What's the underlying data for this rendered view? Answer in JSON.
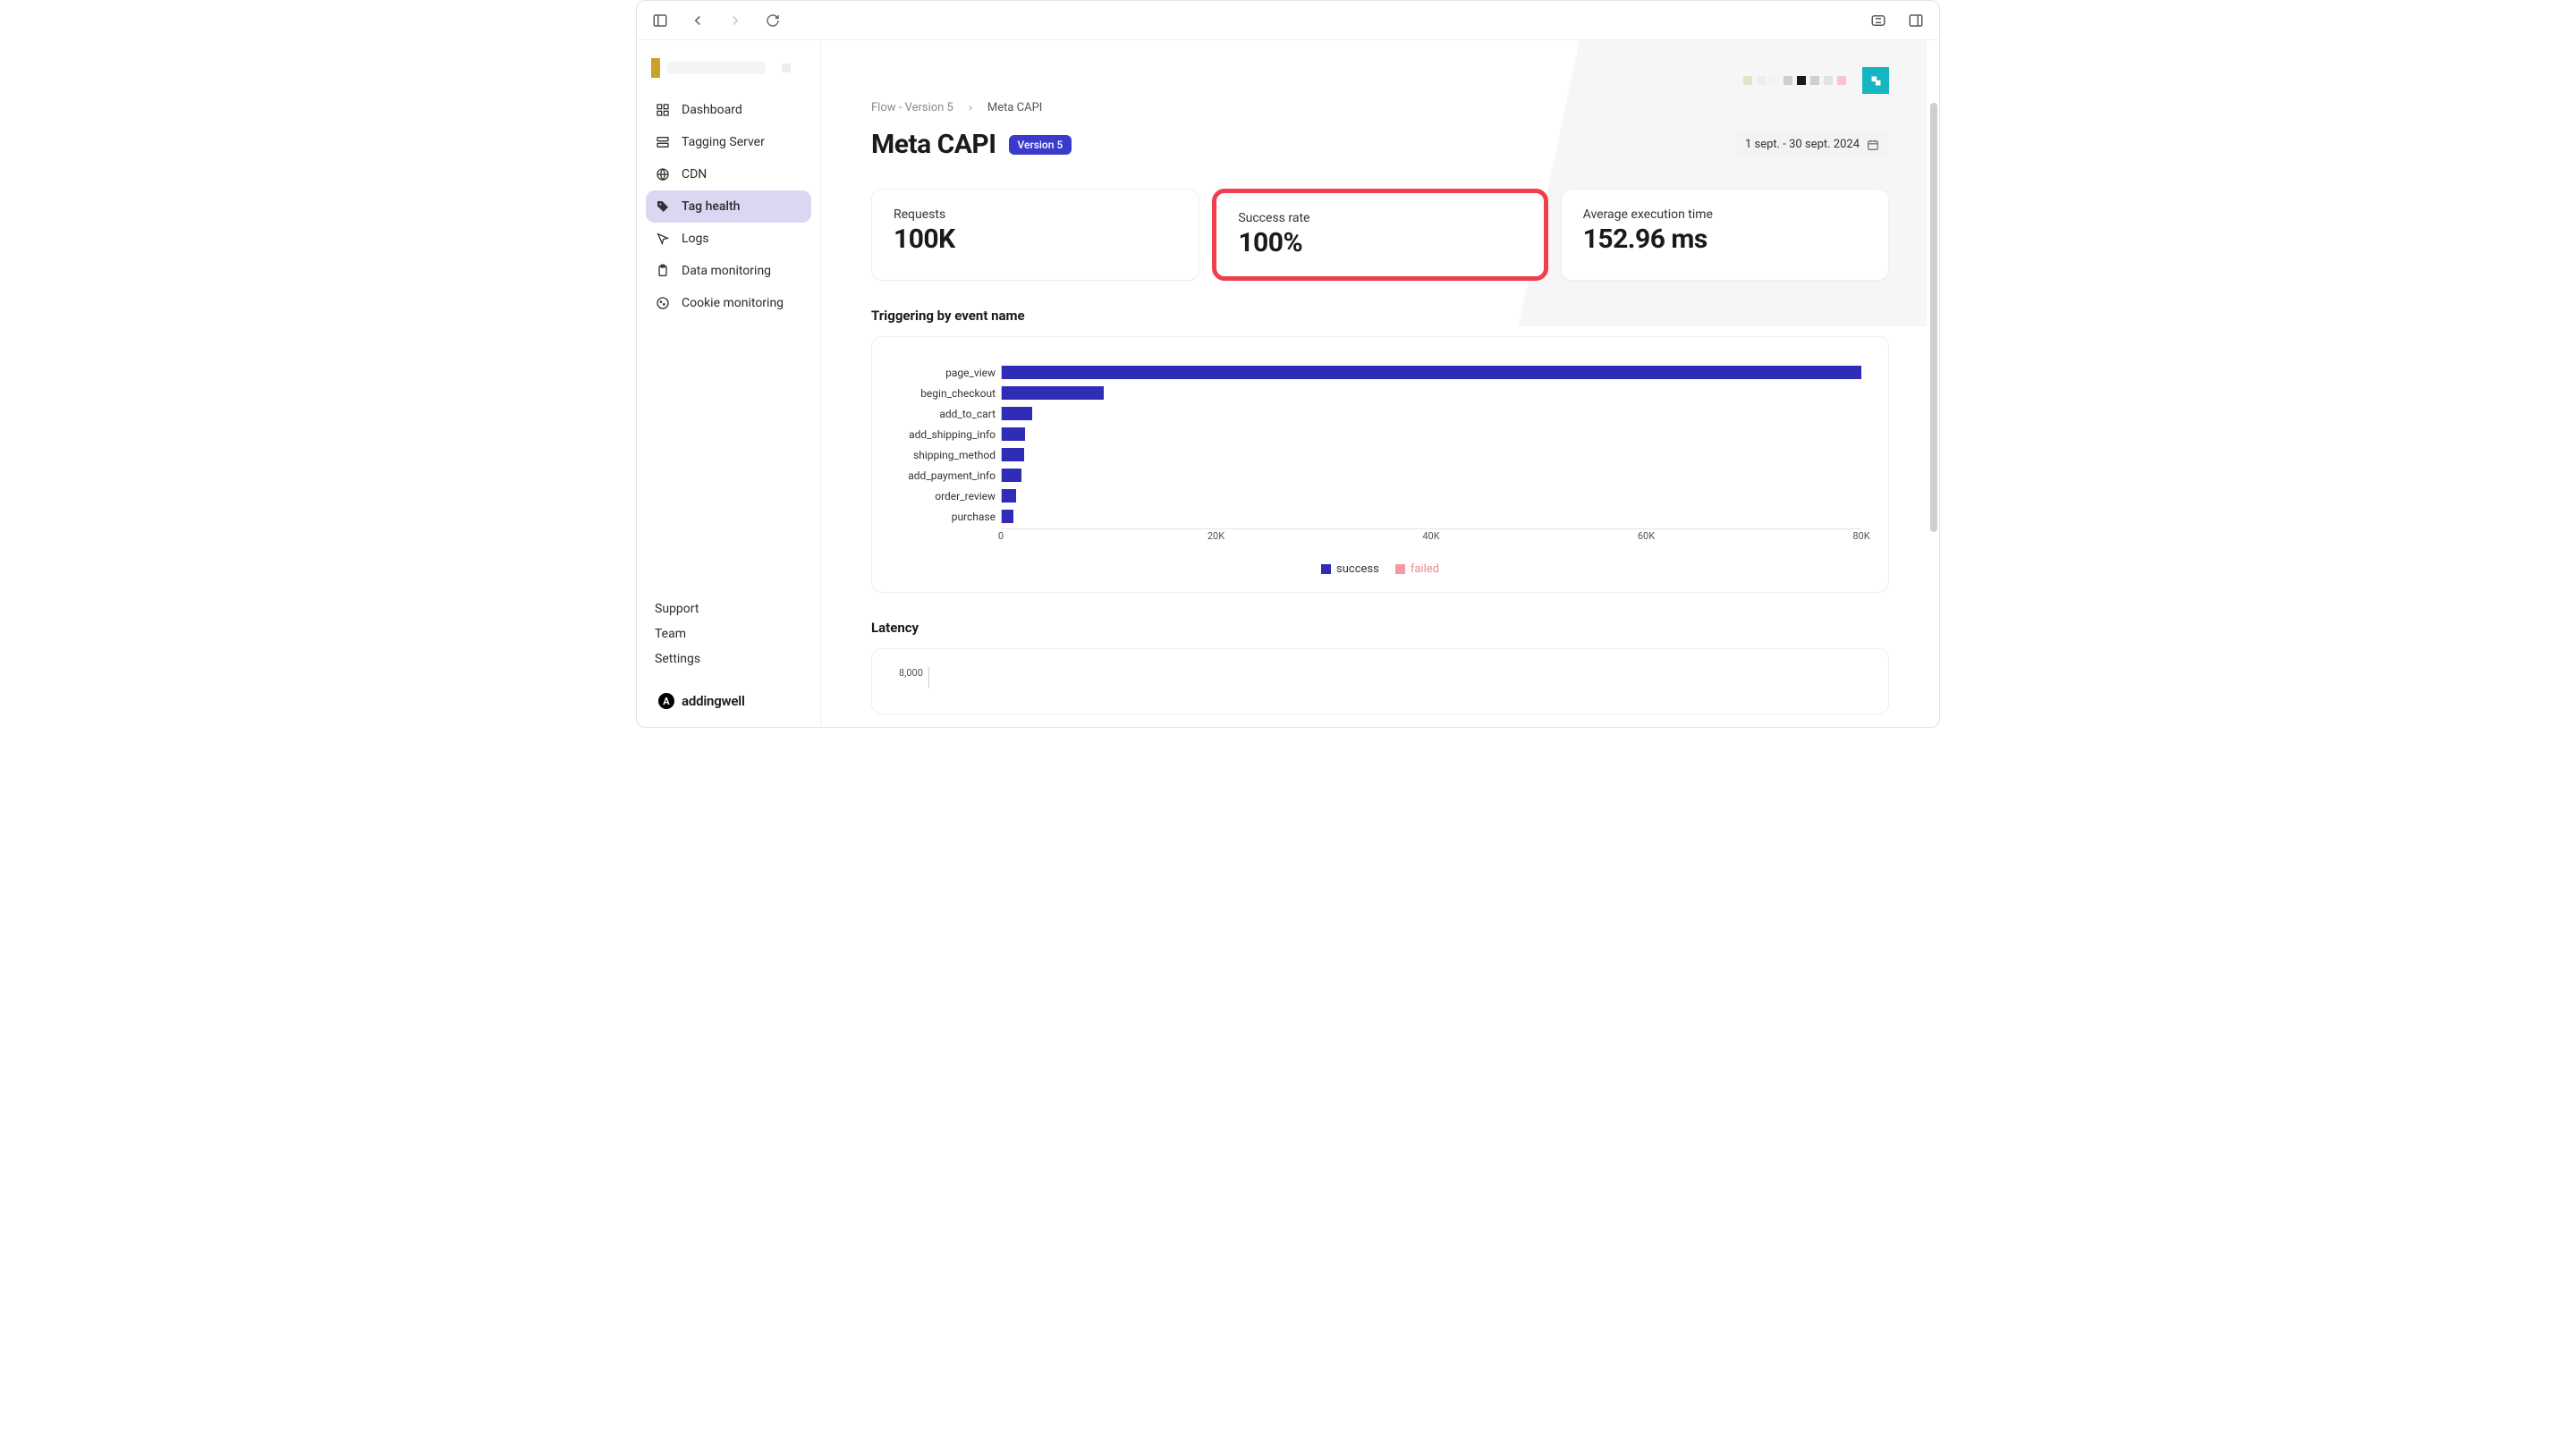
{
  "sidebar": {
    "items": [
      {
        "label": "Dashboard",
        "icon": "grid-icon"
      },
      {
        "label": "Tagging Server",
        "icon": "server-icon"
      },
      {
        "label": "CDN",
        "icon": "globe-icon"
      },
      {
        "label": "Tag health",
        "icon": "tag-icon",
        "active": true
      },
      {
        "label": "Logs",
        "icon": "cursor-icon"
      },
      {
        "label": "Data monitoring",
        "icon": "clipboard-icon"
      },
      {
        "label": "Cookie monitoring",
        "icon": "cookie-icon"
      }
    ],
    "bottom": [
      {
        "label": "Support"
      },
      {
        "label": "Team"
      },
      {
        "label": "Settings"
      }
    ],
    "brand": "addingwell"
  },
  "breadcrumb": {
    "parent": "Flow - Version 5",
    "current": "Meta CAPI"
  },
  "page": {
    "title": "Meta CAPI",
    "version_badge": "Version 5",
    "date_range": "1 sept. - 30 sept. 2024"
  },
  "header_colors": [
    "#e7e2c7",
    "#eee",
    "#f3f3f3",
    "#cfcfcf",
    "#1a1a1a",
    "#cfcfcf",
    "#e3e3e3",
    "#f7c4cc"
  ],
  "stats": [
    {
      "label": "Requests",
      "value": "100K"
    },
    {
      "label": "Success rate",
      "value": "100%",
      "highlight": true
    },
    {
      "label": "Average execution time",
      "value": "152.96 ms"
    }
  ],
  "chart_section_title": "Triggering by event name",
  "chart_data": {
    "type": "bar",
    "orientation": "horizontal",
    "categories": [
      "page_view",
      "begin_checkout",
      "add_to_cart",
      "add_shipping_info",
      "shipping_method",
      "add_payment_info",
      "order_review",
      "purchase"
    ],
    "series": [
      {
        "name": "success",
        "color": "#2f2cb6",
        "values": [
          80000,
          9500,
          2800,
          2200,
          2100,
          1800,
          1300,
          1100
        ]
      },
      {
        "name": "failed",
        "color": "#f59aa5",
        "values": [
          0,
          0,
          0,
          0,
          0,
          0,
          0,
          0
        ]
      }
    ],
    "xlim": [
      0,
      80000
    ],
    "xticks": [
      0,
      20000,
      40000,
      60000,
      80000
    ],
    "xtick_labels": [
      "0",
      "20K",
      "40K",
      "60K",
      "80K"
    ],
    "xlabel": "",
    "ylabel": "",
    "title": ""
  },
  "latency_section_title": "Latency",
  "latency_ytick": "8,000"
}
